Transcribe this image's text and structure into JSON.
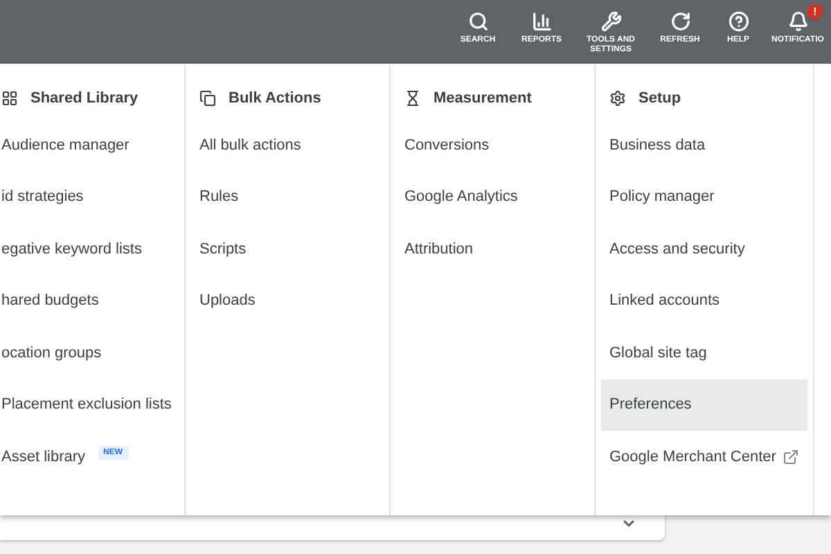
{
  "toolbar": [
    {
      "kind": "search",
      "label": "SEARCH"
    },
    {
      "kind": "reports",
      "label": "REPORTS"
    },
    {
      "kind": "tools",
      "label": "TOOLS AND SETTINGS"
    },
    {
      "kind": "refresh",
      "label": "REFRESH"
    },
    {
      "kind": "help",
      "label": "HELP"
    },
    {
      "kind": "notifications",
      "label": "NOTIFICATIO",
      "badge": "!"
    }
  ],
  "columns": [
    {
      "title": "Shared Library",
      "items": [
        {
          "label": "Audience manager",
          "selected": false
        },
        {
          "label": "id strategies",
          "selected": false
        },
        {
          "label": "egative keyword lists",
          "selected": false
        },
        {
          "label": "hared budgets",
          "selected": false
        },
        {
          "label": "ocation groups",
          "selected": false
        },
        {
          "label": "Placement exclusion lists",
          "selected": false
        },
        {
          "label": "Asset library",
          "selected": false,
          "badge": "NEW"
        }
      ]
    },
    {
      "title": "Bulk Actions",
      "items": [
        {
          "label": "All bulk actions",
          "selected": false
        },
        {
          "label": "Rules",
          "selected": false
        },
        {
          "label": "Scripts",
          "selected": false
        },
        {
          "label": "Uploads",
          "selected": false
        }
      ]
    },
    {
      "title": "Measurement",
      "items": [
        {
          "label": "Conversions",
          "selected": false
        },
        {
          "label": "Google Analytics",
          "selected": false
        },
        {
          "label": "Attribution",
          "selected": false
        }
      ]
    },
    {
      "title": "Setup",
      "items": [
        {
          "label": "Business data",
          "selected": false
        },
        {
          "label": "Policy manager",
          "selected": false
        },
        {
          "label": "Access and security",
          "selected": false
        },
        {
          "label": "Linked accounts",
          "selected": false
        },
        {
          "label": "Global site tag",
          "selected": false
        },
        {
          "label": "Preferences",
          "selected": true
        },
        {
          "label": "Google Merchant Center",
          "selected": false,
          "external": true
        }
      ]
    }
  ]
}
